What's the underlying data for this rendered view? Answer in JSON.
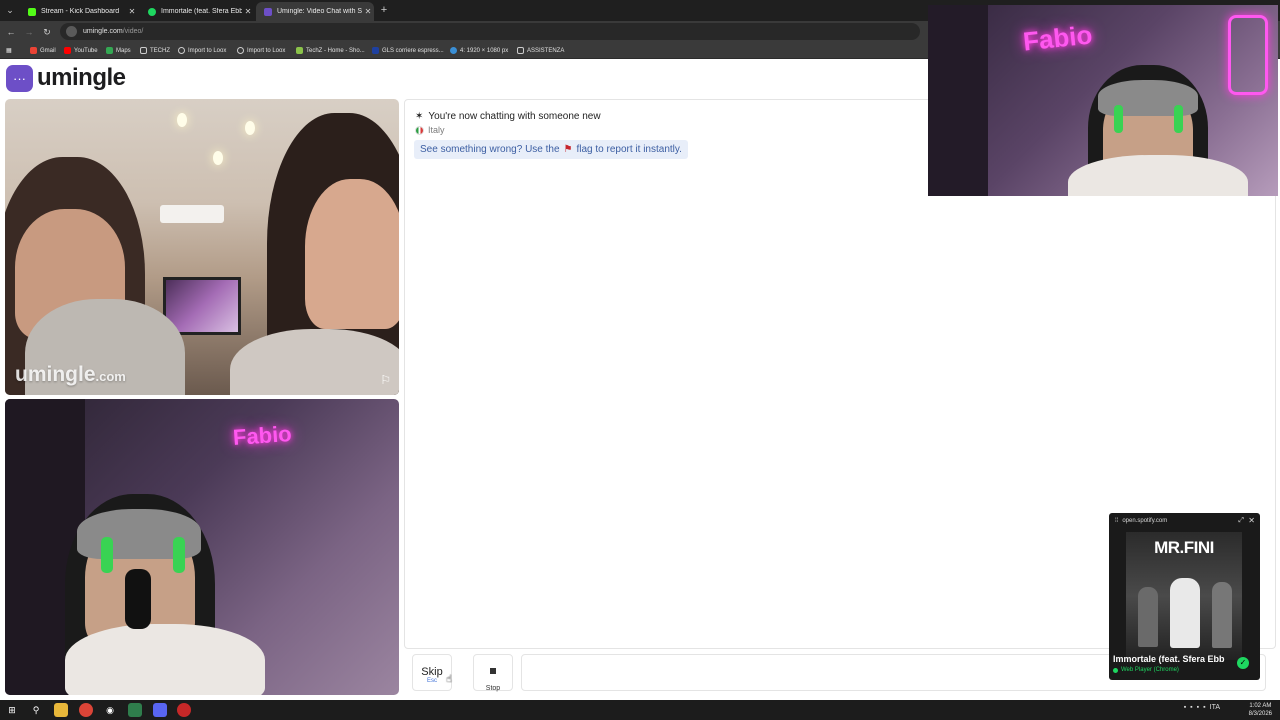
{
  "browser": {
    "tabs": [
      {
        "label": "Stream - Kick Dashboard",
        "color": "#53fc18"
      },
      {
        "label": "Immortale (feat. Sfera Ebb",
        "color": "#1ed760"
      },
      {
        "label": "Umingle: Video Chat with S",
        "color": "#6d4fc7"
      }
    ],
    "new_tab": "+",
    "url_host": "umingle.com",
    "url_path": "/video/",
    "bookmarks": [
      "Gmail",
      "YouTube",
      "Maps",
      "TECHZ",
      "Import to Loox",
      "Import to Loox",
      "TechZ - Home - Sho...",
      "GLS corriere espress...",
      "4: 1920 × 1080 px",
      "ASSISTENZA"
    ]
  },
  "site": {
    "logo_text": "umingle",
    "accent": "#6d4fc7"
  },
  "stranger": {
    "watermark_main": "umingle",
    "watermark_domain": ".com"
  },
  "chat": {
    "status": "You're now chatting with someone new",
    "country": "Italy",
    "report_prefix": "See something wrong? Use the",
    "report_suffix": "flag to report it instantly."
  },
  "controls": {
    "skip_label": "Skip",
    "skip_shortcut": "Esc",
    "stop_label": "Stop"
  },
  "overlay": {
    "neon_text": "Fabio"
  },
  "spotify": {
    "origin": "open.spotify.com",
    "cover_title": "MR.FINI",
    "song": "Immortale (feat. Sfera Ebb",
    "player": "Web Player (Chrome)",
    "brand_color": "#1ed760"
  },
  "taskbar": {
    "lang": "ITA",
    "time": "1:02 AM",
    "date": "8/3/2026"
  }
}
